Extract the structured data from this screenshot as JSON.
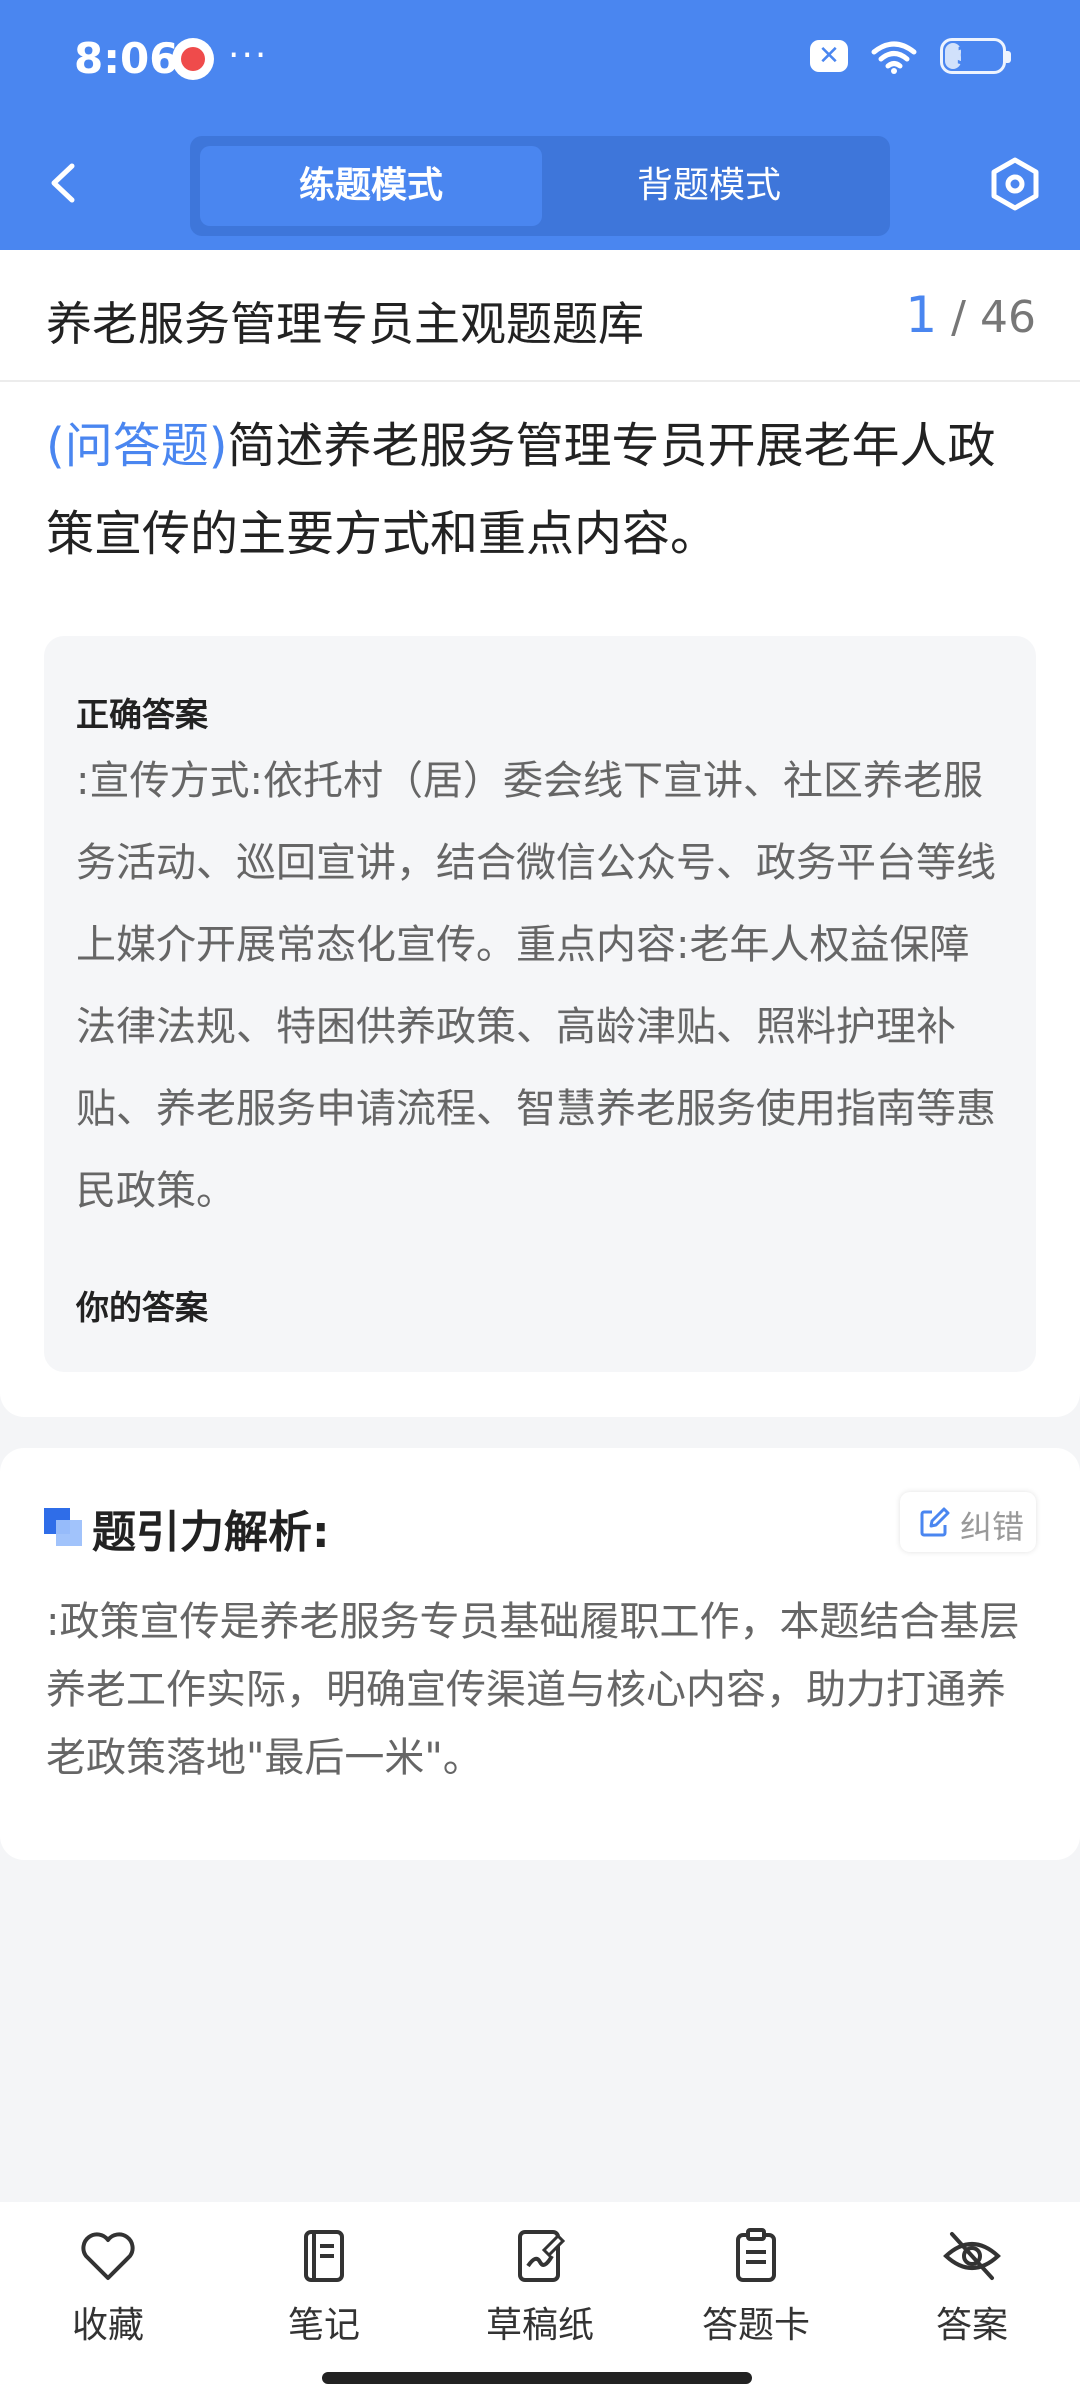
{
  "status_bar": {
    "time": "8:06",
    "dots": "···",
    "x_badge": "✕",
    "battery": "33",
    "battery_level": 0.33
  },
  "header": {
    "modes": [
      "练题模式",
      "背题模式"
    ],
    "active_mode": "练题模式",
    "accent_color": "#4a86f0"
  },
  "question_bank": {
    "title": "养老服务管理专员主观题题库",
    "current": "1",
    "separator": "/",
    "total": "46"
  },
  "question": {
    "type": "(问答题)",
    "text": "简述养老服务管理专员开展老年人政策宣传的主要方式和重点内容。"
  },
  "answer": {
    "correct_label": "正确答案",
    "correct_text": ":宣传方式:依托村（居）委会线下宣讲、社区养老服务活动、巡回宣讲，结合微信公众号、政务平台等线上媒介开展常态化宣传。重点内容:老年人权益保障法律法规、特困供养政策、高龄津贴、照料护理补贴、养老服务申请流程、智慧养老服务使用指南等惠民政策。",
    "your_label": "你的答案"
  },
  "analysis": {
    "title": "题引力解析:",
    "correct_button": "纠错",
    "text": ":政策宣传是养老服务专员基础履职工作，本题结合基层养老工作实际，明确宣传渠道与核心内容，助力打通养老政策落地\"最后一米\"。"
  },
  "bottom_nav": {
    "items": [
      {
        "label": "收藏",
        "icon": "heart-icon"
      },
      {
        "label": "笔记",
        "icon": "notebook-icon"
      },
      {
        "label": "草稿纸",
        "icon": "draft-paper-icon"
      },
      {
        "label": "答题卡",
        "icon": "answer-sheet-icon"
      },
      {
        "label": "答案",
        "icon": "eye-off-icon"
      }
    ]
  }
}
